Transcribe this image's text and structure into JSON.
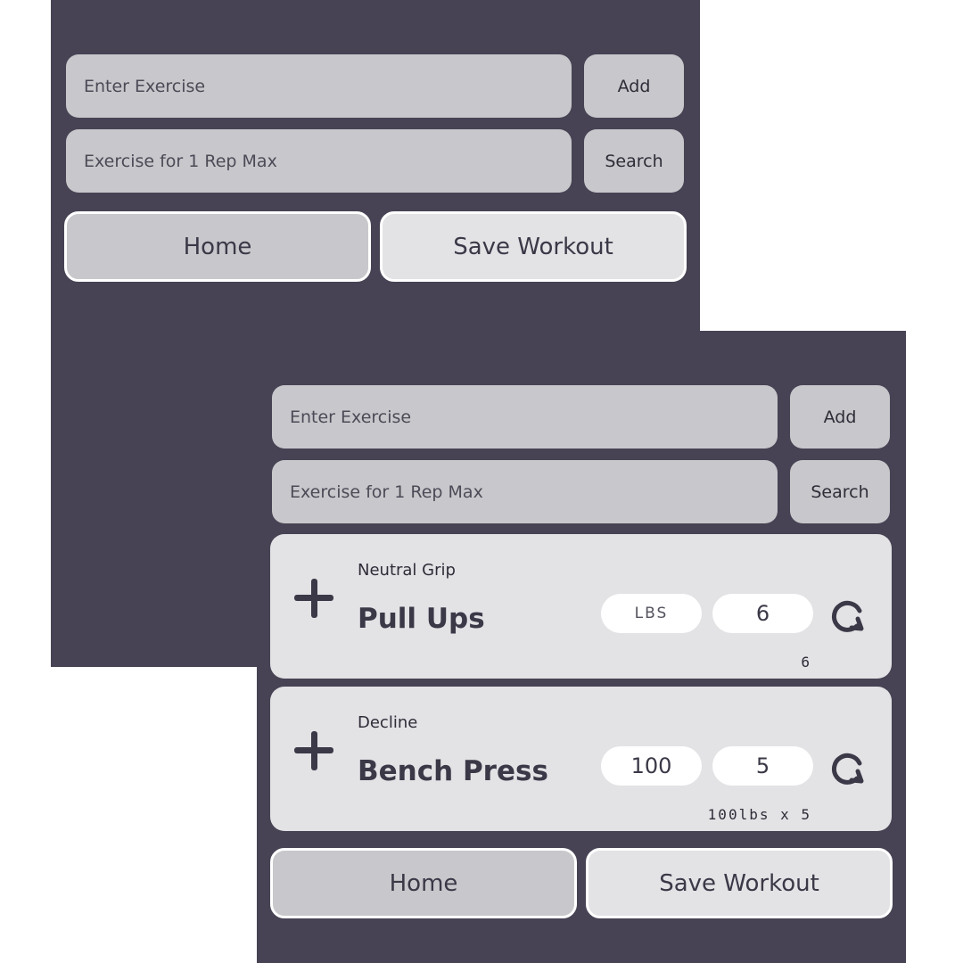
{
  "screens": [
    {
      "add_form": {
        "exercise_placeholder": "Enter Exercise",
        "add_label": "Add"
      },
      "search_form": {
        "placeholder": "Exercise for 1 Rep Max",
        "search_label": "Search"
      },
      "nav": {
        "home_label": "Home",
        "save_label": "Save Workout"
      }
    },
    {
      "add_form": {
        "exercise_placeholder": "Enter Exercise",
        "add_label": "Add"
      },
      "search_form": {
        "placeholder": "Exercise for 1 Rep Max",
        "search_label": "Search"
      },
      "exercises": [
        {
          "variant": "Neutral Grip",
          "name": "Pull Ups",
          "weight": "LBS",
          "reps": "6",
          "result": "6"
        },
        {
          "variant": "Decline",
          "name": "Bench Press",
          "weight": "100",
          "reps": "5",
          "result": "100lbs x 5"
        }
      ],
      "nav": {
        "home_label": "Home",
        "save_label": "Save Workout"
      }
    }
  ],
  "colors": {
    "panel_bg": "#474354",
    "field_bg": "#c8c7cb",
    "card_bg": "#e3e2e5",
    "text_dark": "#3b3847"
  },
  "icons": {
    "add": "plus-icon",
    "refresh": "refresh-icon"
  }
}
